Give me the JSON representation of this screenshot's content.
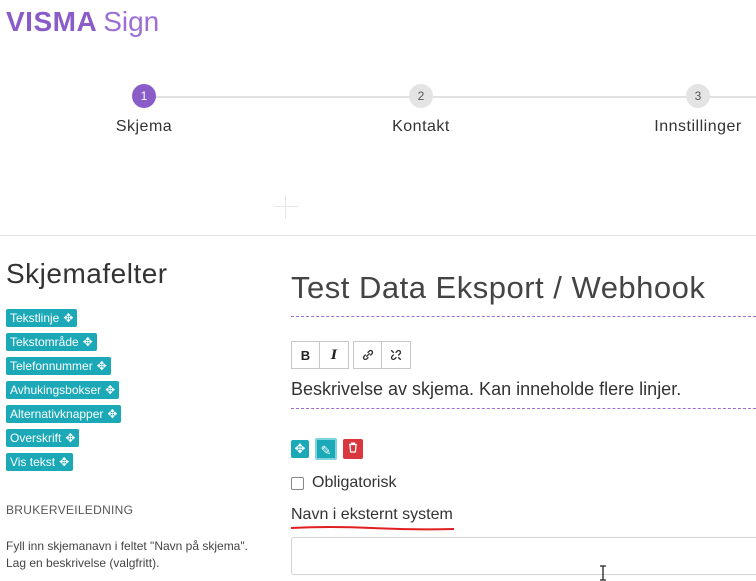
{
  "logo": {
    "bold": "VISMA",
    "light": "Sign"
  },
  "steps": [
    {
      "number": "1",
      "label": "Skjema",
      "active": true
    },
    {
      "number": "2",
      "label": "Kontakt",
      "active": false
    },
    {
      "number": "3",
      "label": "Innstillinger",
      "active": false
    }
  ],
  "sidebar": {
    "title": "Skjemafelter",
    "fields": [
      {
        "label": "Tekstlinje",
        "icon": "move-icon"
      },
      {
        "label": "Tekstområde",
        "icon": "move-icon"
      },
      {
        "label": "Telefonnummer",
        "icon": "move-icon"
      },
      {
        "label": "Avhukingsbokser",
        "icon": "move-icon"
      },
      {
        "label": "Alternativknapper",
        "icon": "move-icon"
      },
      {
        "label": "Overskrift",
        "icon": "move-icon"
      },
      {
        "label": "Vis tekst",
        "icon": "move-icon"
      }
    ],
    "guide_title": "BRUKERVEILEDNING",
    "guide_text": "Fyll inn skjemanavn i feltet \"Navn på skjema\". Lag en beskrivelse (valgfritt)."
  },
  "form": {
    "title": "Test Data Eksport / Webhook",
    "toolbar": {
      "bold_label": "B",
      "italic_label": "I",
      "icons": [
        "bold-icon",
        "italic-icon",
        "link-icon",
        "unlink-icon"
      ]
    },
    "description": "Beskrivelse av skjema. Kan inneholde flere linjer.",
    "field_actions": {
      "icons": [
        "move-icon",
        "pencil-icon",
        "trash-icon"
      ]
    },
    "required_label": "Obligatorisk",
    "external_label": "Navn i eksternt system",
    "external_value": ""
  },
  "colors": {
    "brand_purple": "#8a5cc7",
    "teal": "#1ba9b8",
    "danger": "#d9363e",
    "annotation_red": "#e02020"
  }
}
